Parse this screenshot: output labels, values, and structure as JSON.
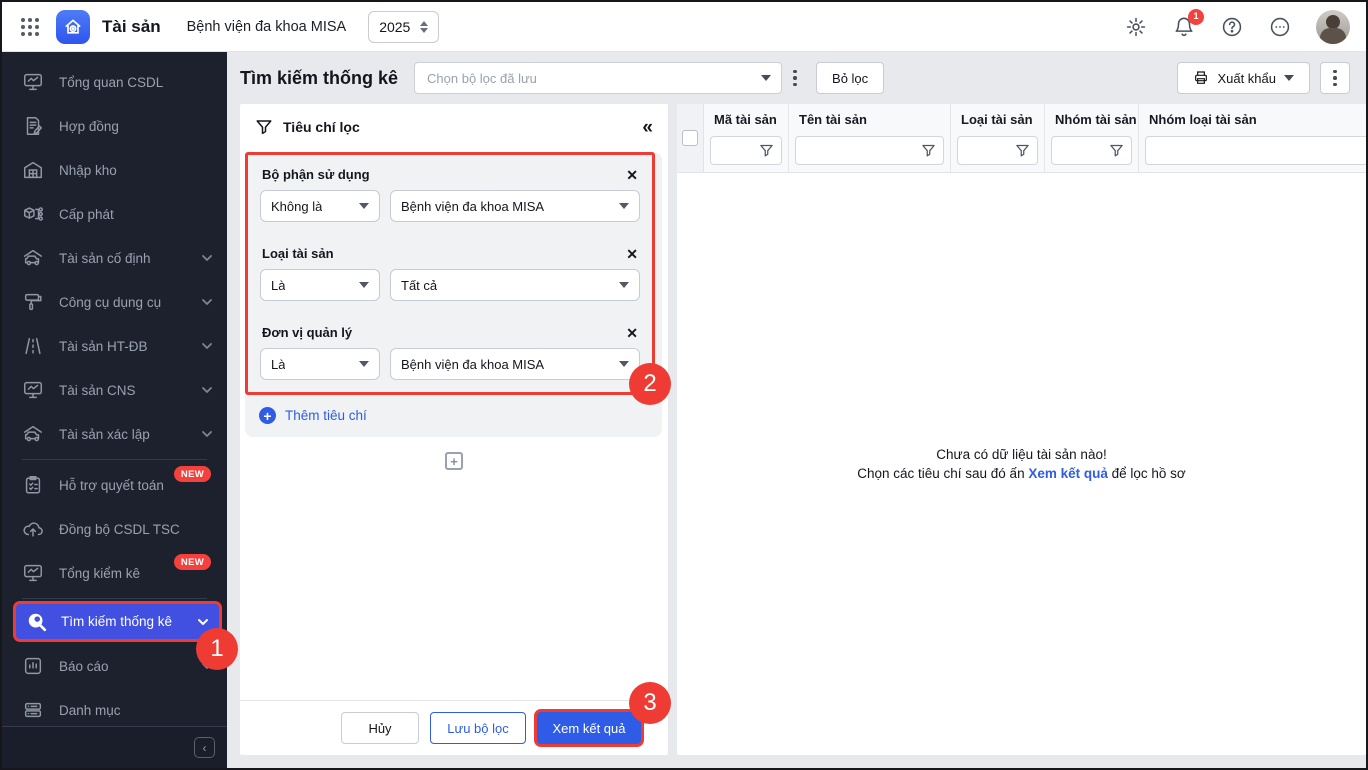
{
  "topbar": {
    "app_title": "Tài sản",
    "org_name": "Bệnh viện đa khoa MISA",
    "year": "2025",
    "notification_count": "1"
  },
  "sidebar": {
    "items": [
      {
        "label": "Tổng quan CSDL"
      },
      {
        "label": "Hợp đồng"
      },
      {
        "label": "Nhập kho"
      },
      {
        "label": "Cấp phát"
      },
      {
        "label": "Tài sản cố định"
      },
      {
        "label": "Công cụ dụng cụ"
      },
      {
        "label": "Tài sản HT-ĐB"
      },
      {
        "label": "Tài sản CNS"
      },
      {
        "label": "Tài sản xác lập"
      },
      {
        "label": "Hỗ trợ quyết toán",
        "badge": "NEW"
      },
      {
        "label": "Đồng bộ CSDL TSC"
      },
      {
        "label": "Tổng kiểm kê",
        "badge": "NEW"
      },
      {
        "label": "Tìm kiếm thống kê"
      },
      {
        "label": "Báo cáo"
      },
      {
        "label": "Danh mục"
      }
    ]
  },
  "header": {
    "page_title": "Tìm kiếm thống kê",
    "saved_filter_placeholder": "Chọn bộ lọc đã lưu",
    "clear_filter_label": "Bỏ lọc",
    "export_label": "Xuất khẩu"
  },
  "filter_panel": {
    "title": "Tiêu chí lọc",
    "criteria": [
      {
        "label": "Bộ phận sử dụng",
        "operator": "Không là",
        "value": "Bệnh viện đa khoa MISA"
      },
      {
        "label": "Loại tài sản",
        "operator": "Là",
        "value": "Tất cả"
      },
      {
        "label": "Đơn vị quản lý",
        "operator": "Là",
        "value": "Bệnh viện đa khoa MISA"
      }
    ],
    "add_criteria_label": "Thêm tiêu chí",
    "cancel_label": "Hủy",
    "save_filter_label": "Lưu bộ lọc",
    "view_results_label": "Xem kết quả"
  },
  "table": {
    "columns": [
      "Mã tài sản",
      "Tên tài sản",
      "Loại tài sản",
      "Nhóm tài sản",
      "Nhóm loại tài sản"
    ],
    "empty_state": {
      "line1": "Chưa có dữ liệu tài sản nào!",
      "line2_prefix": "Chọn các tiêu chí sau đó ấn ",
      "line2_link": "Xem kết quả",
      "line2_suffix": " để lọc hồ sơ"
    }
  },
  "annotations": {
    "step1": "1",
    "step2": "2",
    "step3": "3"
  }
}
